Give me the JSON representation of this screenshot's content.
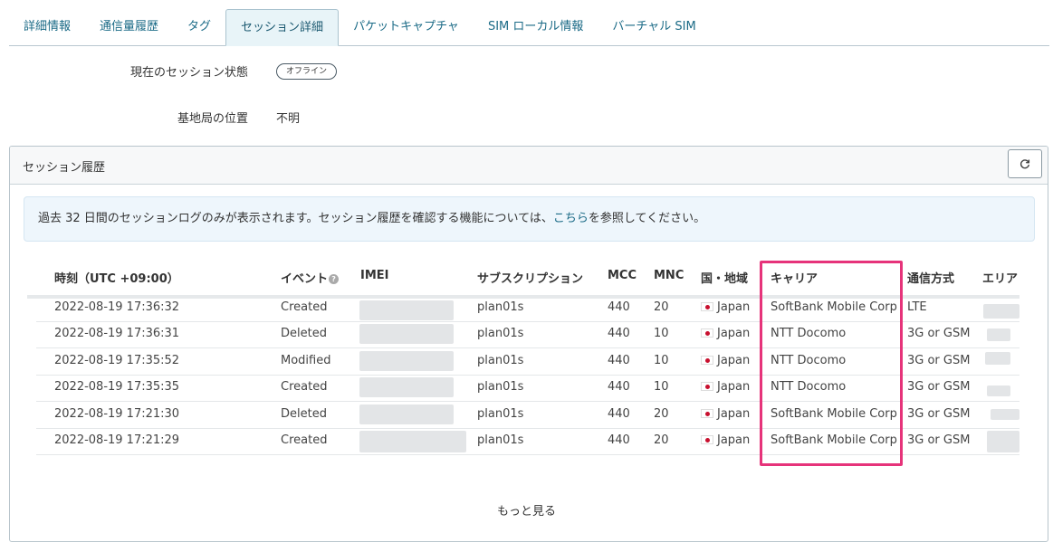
{
  "tabs": [
    "詳細情報",
    "通信量履歴",
    "タグ",
    "セッション詳細",
    "パケットキャプチャ",
    "SIM ローカル情報",
    "バーチャル SIM"
  ],
  "status": {
    "label": "現在のセッション状態",
    "value": "オフライン"
  },
  "location": {
    "label": "基地局の位置",
    "value": "不明"
  },
  "panel": {
    "title": "セッション履歴",
    "info_before": "過去 32 日間のセッションログのみが表示されます。セッション履歴を確認する機能については、",
    "info_link": "こちら",
    "info_after": "を参照してください。"
  },
  "columns": [
    "時刻（UTC +09:00）",
    "イベント",
    "IMEI",
    "サブスクリプション",
    "MCC",
    "MNC",
    "国・地域",
    "キャリア",
    "通信方式",
    "エリア"
  ],
  "rows": [
    {
      "time": "2022-08-19 17:36:32",
      "event": "Created",
      "sub": "plan01s",
      "mcc": "440",
      "mnc": "20",
      "country": "Japan",
      "carrier": "SoftBank Mobile Corp",
      "rat": "LTE"
    },
    {
      "time": "2022-08-19 17:36:31",
      "event": "Deleted",
      "sub": "plan01s",
      "mcc": "440",
      "mnc": "10",
      "country": "Japan",
      "carrier": "NTT Docomo",
      "rat": "3G or GSM"
    },
    {
      "time": "2022-08-19 17:35:52",
      "event": "Modified",
      "sub": "plan01s",
      "mcc": "440",
      "mnc": "10",
      "country": "Japan",
      "carrier": "NTT Docomo",
      "rat": "3G or GSM"
    },
    {
      "time": "2022-08-19 17:35:35",
      "event": "Created",
      "sub": "plan01s",
      "mcc": "440",
      "mnc": "10",
      "country": "Japan",
      "carrier": "NTT Docomo",
      "rat": "3G or GSM"
    },
    {
      "time": "2022-08-19 17:21:30",
      "event": "Deleted",
      "sub": "plan01s",
      "mcc": "440",
      "mnc": "20",
      "country": "Japan",
      "carrier": "SoftBank Mobile Corp",
      "rat": "3G or GSM"
    },
    {
      "time": "2022-08-19 17:21:29",
      "event": "Created",
      "sub": "plan01s",
      "mcc": "440",
      "mnc": "20",
      "country": "Japan",
      "carrier": "SoftBank Mobile Corp",
      "rat": "3G or GSM"
    }
  ],
  "more_label": "もっと見る",
  "colors": {
    "link": "#1a6a86",
    "highlight": "#e6337a",
    "info_bg": "#eef6fc"
  }
}
